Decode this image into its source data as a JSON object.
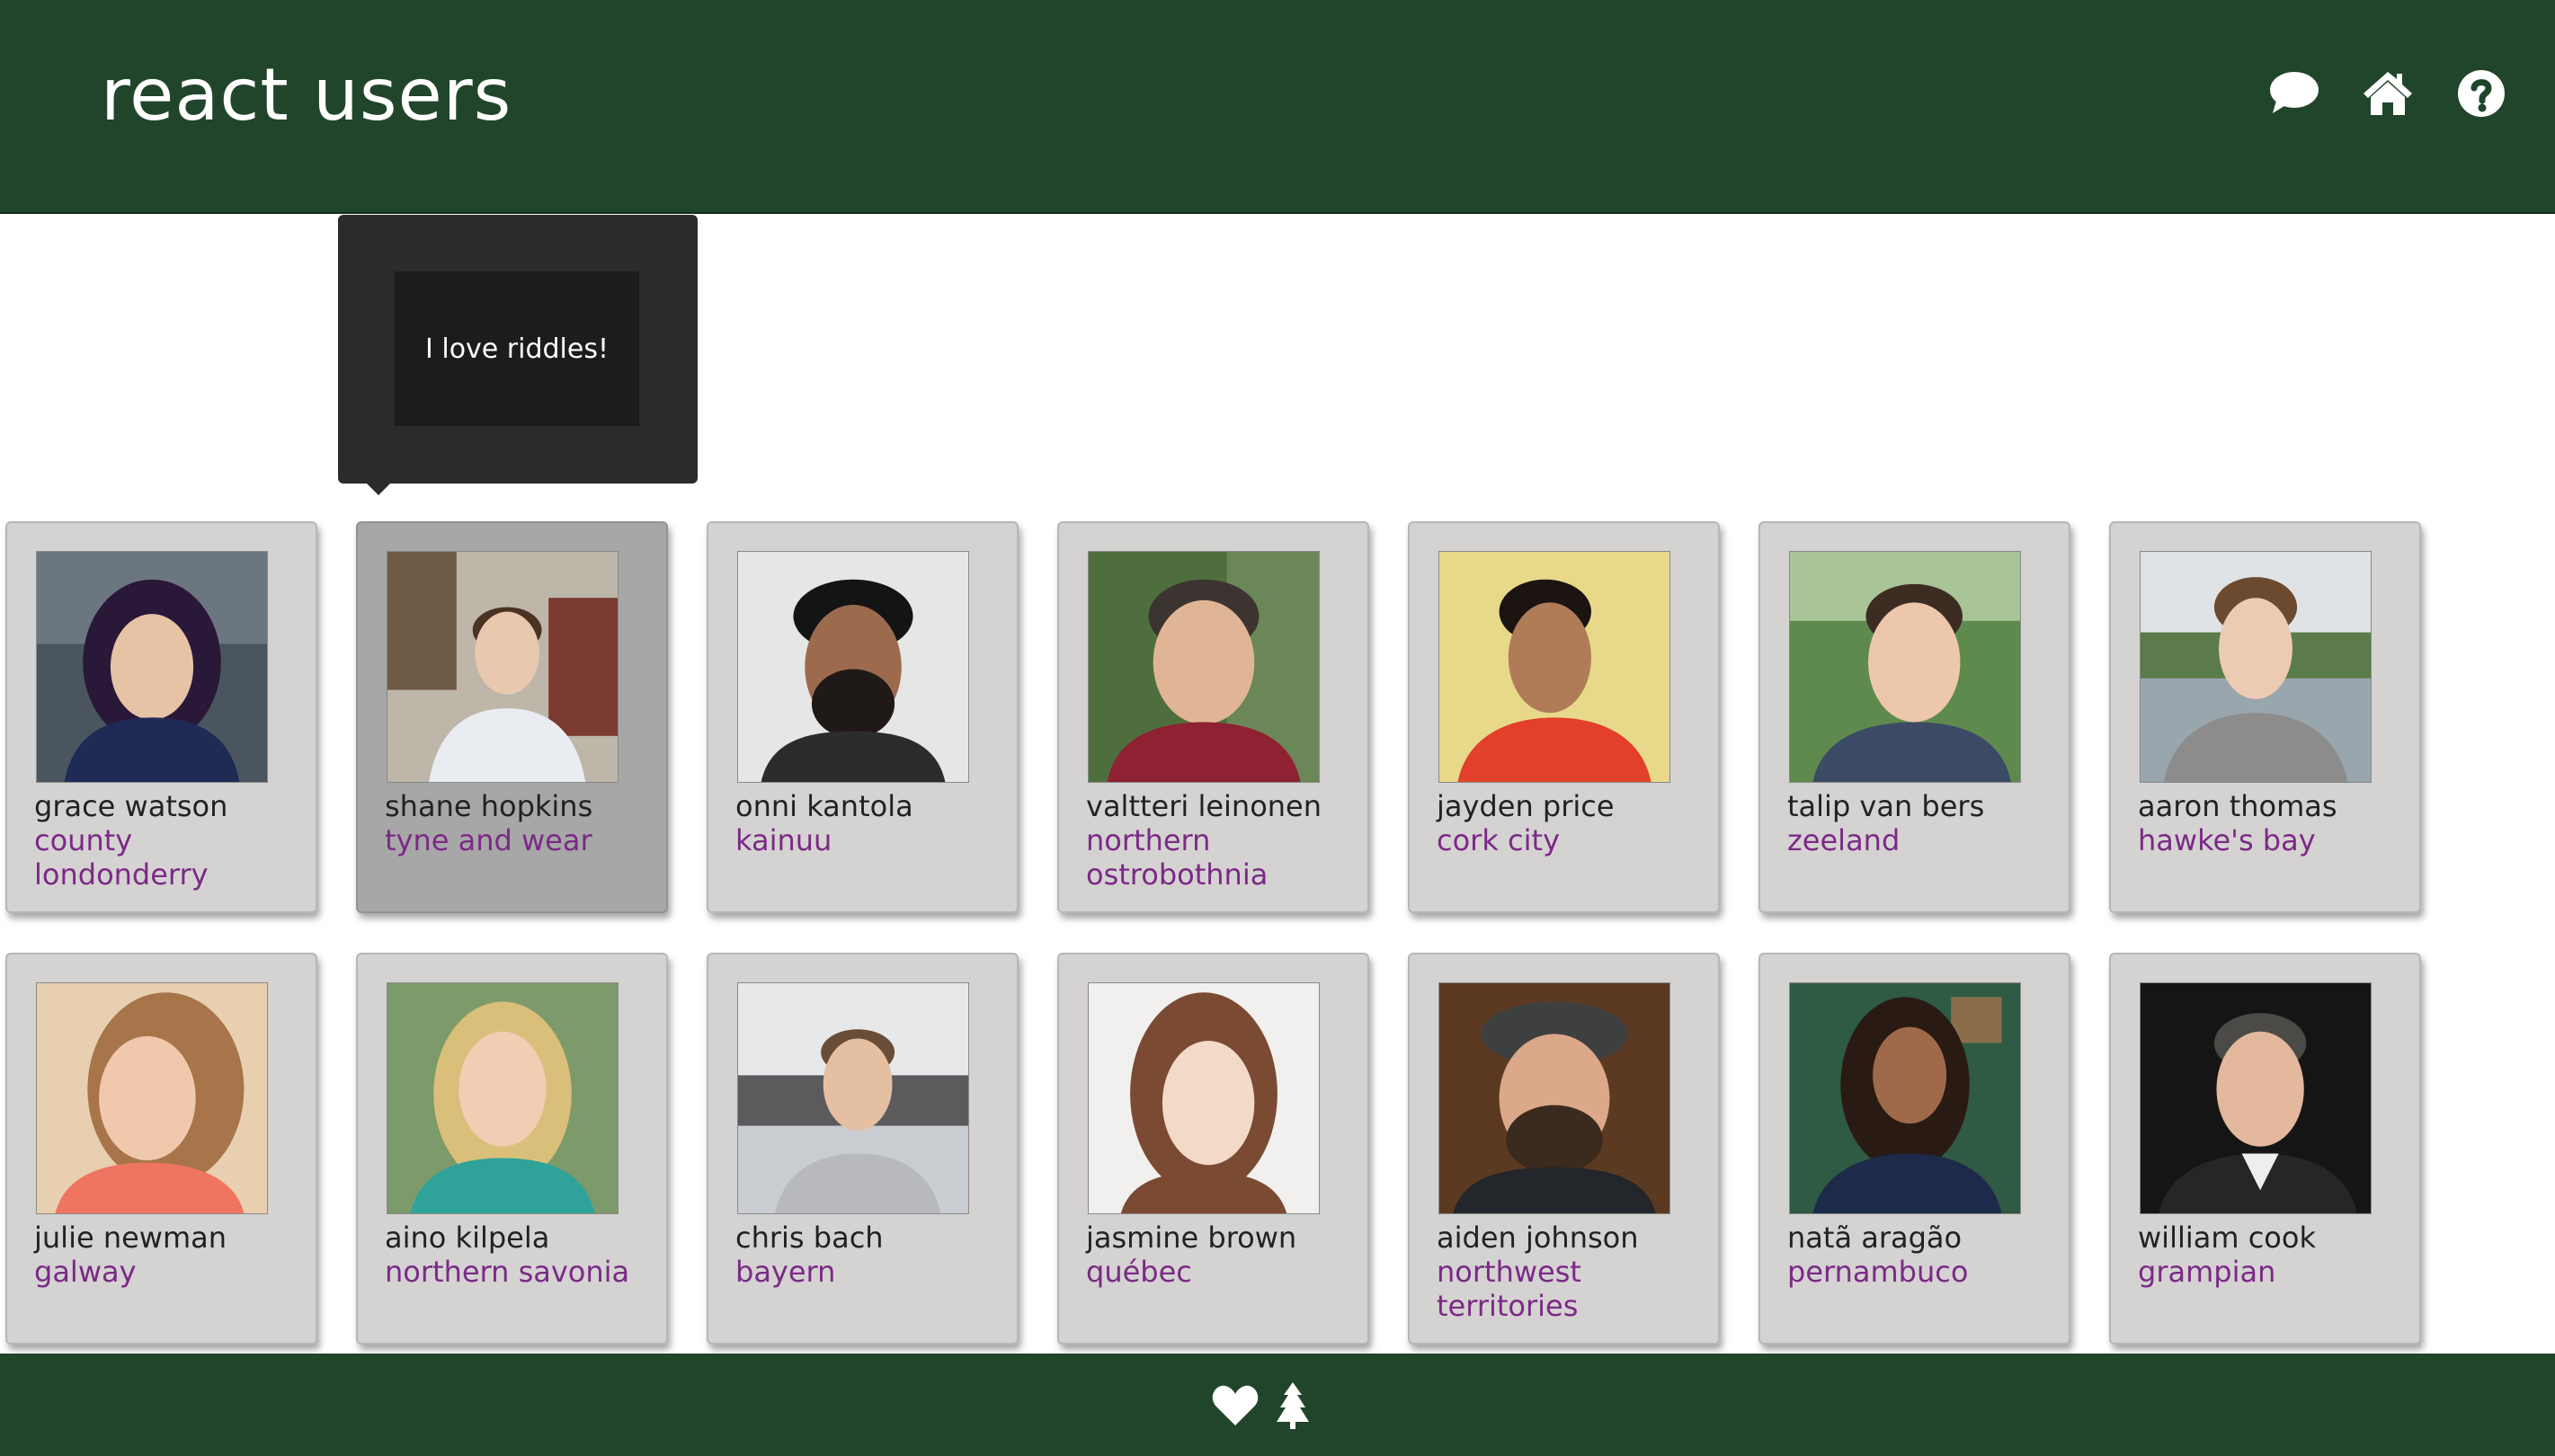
{
  "header": {
    "title": "react users",
    "icons": [
      "comment-icon",
      "home-icon",
      "help-icon"
    ],
    "background": "#21452b"
  },
  "tooltip": {
    "text": "I love riddles!"
  },
  "users": [
    {
      "name": "grace watson",
      "region": "county londonderry"
    },
    {
      "name": "shane hopkins",
      "region": "tyne and wear"
    },
    {
      "name": "onni kantola",
      "region": "kainuu"
    },
    {
      "name": "valtteri leinonen",
      "region": "northern ostrobothnia"
    },
    {
      "name": "jayden price",
      "region": "cork city"
    },
    {
      "name": "talip van bers",
      "region": "zeeland"
    },
    {
      "name": "aaron thomas",
      "region": "hawke's bay"
    },
    {
      "name": "julie newman",
      "region": "galway"
    },
    {
      "name": "aino kilpela",
      "region": "northern savonia"
    },
    {
      "name": "chris bach",
      "region": "bayern"
    },
    {
      "name": "jasmine brown",
      "region": "québec"
    },
    {
      "name": "aiden johnson",
      "region": "northwest territories"
    },
    {
      "name": "natã aragão",
      "region": "pernambuco"
    },
    {
      "name": "william cook",
      "region": "grampian"
    }
  ],
  "footer": {
    "icons": [
      "heart-icon",
      "tree-icon"
    ]
  },
  "colors": {
    "brand": "#21452b",
    "region_text": "#7b2a86",
    "card_background": "#d5d2d2",
    "card_hover": "#a7a7a7"
  }
}
